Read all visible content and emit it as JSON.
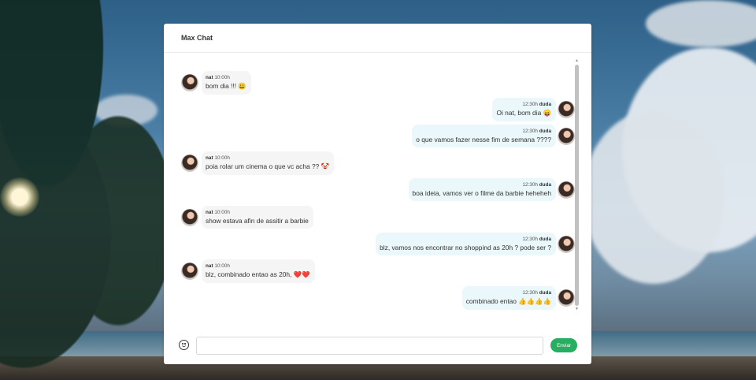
{
  "chat": {
    "title": "Max Chat",
    "messages": [
      {
        "side": "left",
        "author": "nat",
        "time": "10:00h",
        "text": "bom dia !!! 😀"
      },
      {
        "side": "right",
        "author": "duda",
        "time": "12:30h",
        "text": "Oi nat, bom dia 😛"
      },
      {
        "side": "right",
        "author": "duda",
        "time": "12:30h",
        "text": "o que vamos fazer nesse fim de semana ????"
      },
      {
        "side": "left",
        "author": "nat",
        "time": "10:00h",
        "text": "poia rolar um cinema o que vc acha ?? 🤡"
      },
      {
        "side": "right",
        "author": "duda",
        "time": "12:30h",
        "text": "boa ideia, vamos ver o filme da barbie heheheh"
      },
      {
        "side": "left",
        "author": "nat",
        "time": "10:00h",
        "text": "show estava afin de assitir a barbie"
      },
      {
        "side": "right",
        "author": "duda",
        "time": "12:30h",
        "text": "blz, vamos nos encontrar no shoppind as 20h ? pode ser ?"
      },
      {
        "side": "left",
        "author": "nat",
        "time": "10:00h",
        "text": "blz, combinado entao as 20h, ❤️❤️"
      },
      {
        "side": "right",
        "author": "duda",
        "time": "12:30h",
        "text": "combinado entao 👍👍👍👍"
      }
    ]
  },
  "composer": {
    "input_value": "",
    "input_placeholder": "",
    "send_label": "Enviar",
    "emoji_icon": "smiley-icon"
  },
  "colors": {
    "send_button": "#27ae60",
    "bubble_left": "#f5f5f5",
    "bubble_right": "#eaf7fb"
  }
}
